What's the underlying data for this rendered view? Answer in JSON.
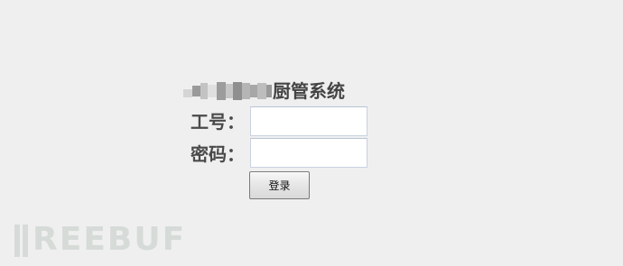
{
  "app": {
    "title": "厨管系统"
  },
  "form": {
    "user_label": "工号：",
    "user_value": "",
    "pass_label": "密码：",
    "pass_value": "",
    "login_label": "登录"
  },
  "watermark": {
    "text": "REEBUF"
  },
  "colors": {
    "background": "#efeff0",
    "label_text": "#4a4a4a",
    "field_border": "#c9d2df",
    "button_border": "#7a7a7a",
    "watermark": "#d6dbd8"
  }
}
